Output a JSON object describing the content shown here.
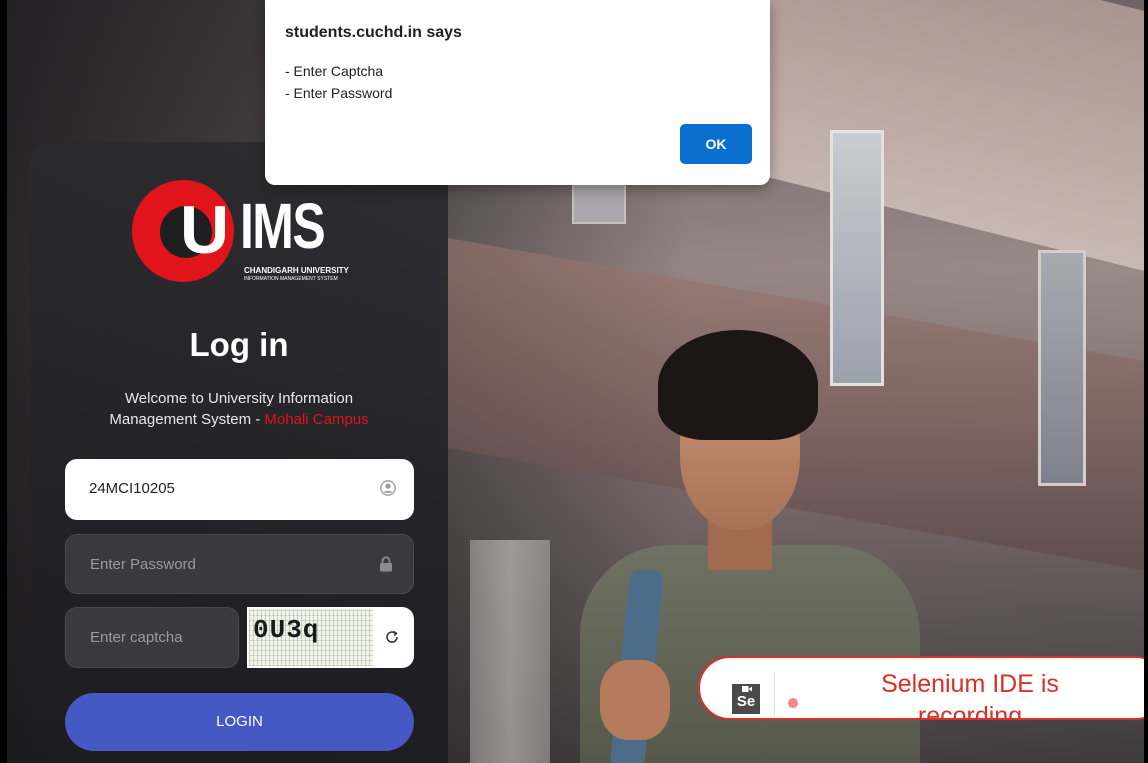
{
  "dialog": {
    "title": "students.cuchd.in says",
    "messages": [
      "- Enter Captcha",
      "- Enter Password"
    ],
    "ok_label": "OK"
  },
  "logo": {
    "mark_letter": "U",
    "wordmark": "IMS",
    "subtitle_line1": "CHANDIGARH UNIVERSITY",
    "subtitle_line2": "INFORMATION MANAGEMENT SYSTEM"
  },
  "login": {
    "title": "Log in",
    "welcome_line1": "Welcome to University Information",
    "welcome_line2": "Management System - ",
    "campus": "Mohali Campus",
    "username_value": "24MCI10205",
    "password_placeholder": "Enter Password",
    "captcha_placeholder": "Enter captcha",
    "captcha_code": "0U3q",
    "login_label": "LOGIN"
  },
  "selenium_badge": {
    "logo_text": "Se",
    "status_text": "Selenium IDE is recording"
  },
  "colors": {
    "accent_red": "#e0141a",
    "login_button": "#4658c4",
    "dialog_ok": "#0b6fd0",
    "selenium_red": "#d93025"
  },
  "icons": [
    "user-icon",
    "lock-icon",
    "refresh-icon",
    "camera-icon",
    "record-dot-icon"
  ]
}
